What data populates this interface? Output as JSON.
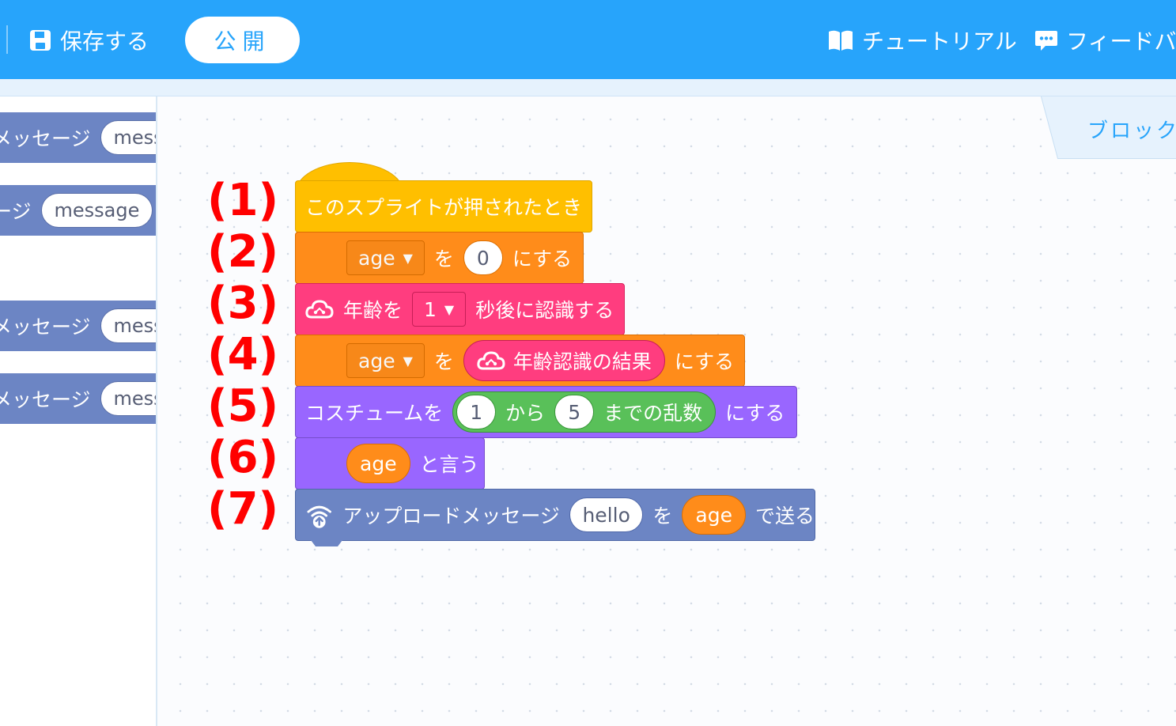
{
  "toolbar": {
    "save_label": "保存する",
    "publish_label": "公開",
    "tutorial_label": "チュートリアル",
    "feedback_label": "フィードバ"
  },
  "block_tab": {
    "label": "ブロック"
  },
  "palette": {
    "items": [
      {
        "label": "メッセージ",
        "value": "mess"
      },
      {
        "label": "ージ",
        "value": "message"
      },
      {
        "label": "メッセージ",
        "value": "mess"
      },
      {
        "label": "メッセージ",
        "value": "mess"
      }
    ]
  },
  "steps": [
    "(1)",
    "(2)",
    "(3)",
    "(4)",
    "(5)",
    "(6)",
    "(7)"
  ],
  "script": {
    "hat": {
      "label": "このスプライトが押されたとき"
    },
    "set_age": {
      "variable": "age",
      "wo": "を",
      "value": "0",
      "suffix": "にする"
    },
    "recognize": {
      "prefix": "年齢を",
      "seconds": "1",
      "suffix": "秒後に認識する"
    },
    "set_age_result": {
      "variable": "age",
      "wo": "を",
      "reporter": "年齢認識の結果",
      "suffix": "にする"
    },
    "costume": {
      "prefix": "コスチュームを",
      "from": "1",
      "kara": "から",
      "to": "5",
      "random": "までの乱数",
      "suffix": "にする"
    },
    "say": {
      "reporter": "age",
      "suffix": "と言う"
    },
    "upload": {
      "prefix": "アップロードメッセージ",
      "message": "hello",
      "wo": "を",
      "reporter": "age",
      "suffix": "で送る"
    }
  },
  "colors": {
    "topbar": "#27a4fb",
    "events": "#ffbf00",
    "variables": "#ff8c1a",
    "ai": "#ff3d7f",
    "looks": "#9966ff",
    "operators": "#59c059",
    "iot": "#6c85c4",
    "step_label": "#ff0000"
  }
}
